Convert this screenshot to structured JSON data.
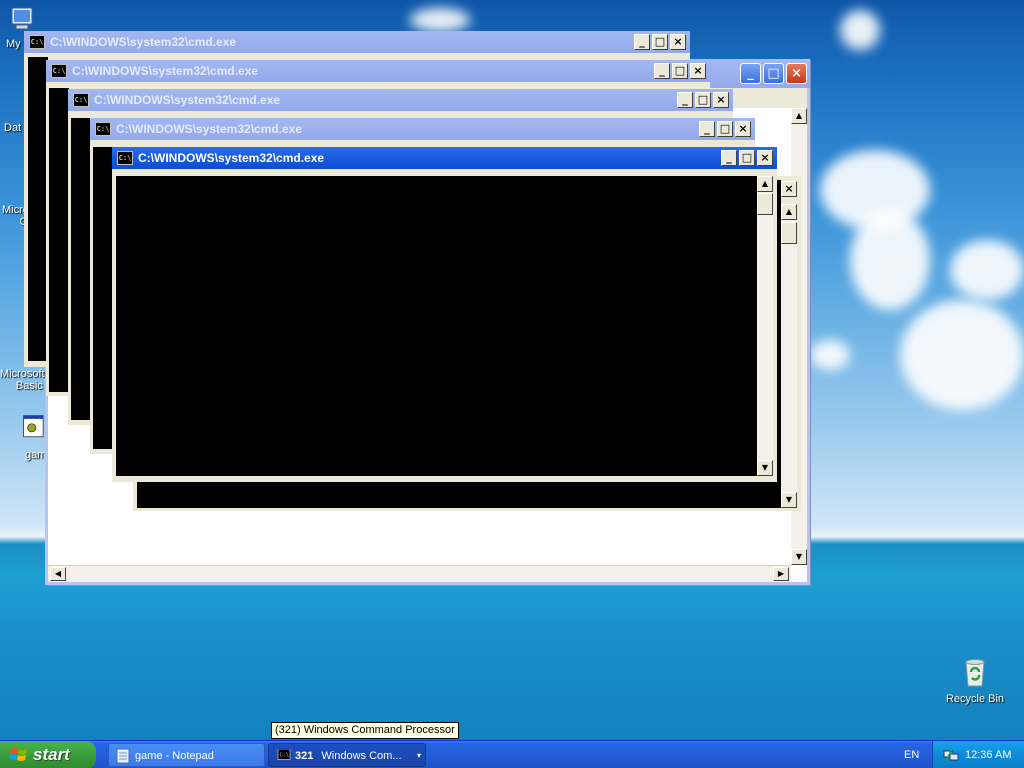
{
  "desktop": {
    "icons": [
      {
        "label": "My"
      },
      {
        "label": "Dat"
      },
      {
        "label": "Micro"
      },
      {
        "label": "C"
      },
      {
        "label": "Microsoft"
      },
      {
        "label": "Basic"
      },
      {
        "label": "gam"
      },
      {
        "label": "Recycle Bin"
      }
    ]
  },
  "cmd_windows": [
    {
      "title": "C:\\WINDOWS\\system32\\cmd.exe"
    },
    {
      "title": "C:\\WINDOWS\\system32\\cmd.exe"
    },
    {
      "title": "C:\\WINDOWS\\system32\\cmd.exe"
    },
    {
      "title": "C:\\WINDOWS\\system32\\cmd.exe"
    },
    {
      "title": "C:\\WINDOWS\\system32\\cmd.exe"
    }
  ],
  "cmd_icon_text": "C:\\",
  "buttons": {
    "minimize": "_",
    "maximize": "□",
    "close": "×"
  },
  "tooltip": "(321) Windows Command Processor",
  "taskbar": {
    "start_label": "start",
    "items": [
      {
        "label": "game - Notepad",
        "icon": "notepad-icon"
      },
      {
        "count": "321",
        "label": "Windows Com...",
        "icon": "cmd-icon"
      }
    ],
    "language": "EN",
    "clock": "12:36 AM"
  },
  "colors": {
    "taskbar": "#245edb",
    "start": "#3c9d3c",
    "tray": "#0f8ad8",
    "active_title": "#0a4cd4"
  }
}
